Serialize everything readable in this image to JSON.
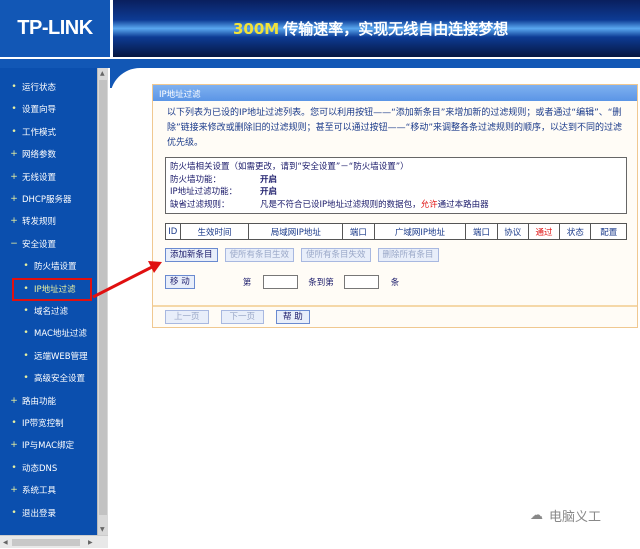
{
  "header": {
    "logo": "TP-LINK",
    "banner_highlight": "300M",
    "banner_text": "传输速率，实现无线自由连接梦想"
  },
  "sidebar": {
    "items": [
      {
        "label": "运行状态",
        "bullet": "•",
        "level": 1
      },
      {
        "label": "设置向导",
        "bullet": "•",
        "level": 1
      },
      {
        "label": "工作模式",
        "bullet": "•",
        "level": 1
      },
      {
        "label": "网络参数",
        "bullet": "+",
        "level": 1
      },
      {
        "label": "无线设置",
        "bullet": "+",
        "level": 1
      },
      {
        "label": "DHCP服务器",
        "bullet": "+",
        "level": 1
      },
      {
        "label": "转发规则",
        "bullet": "+",
        "level": 1
      },
      {
        "label": "安全设置",
        "bullet": "−",
        "level": 1
      },
      {
        "label": "防火墙设置",
        "bullet": "•",
        "level": 2
      },
      {
        "label": "IP地址过滤",
        "bullet": "•",
        "level": 2,
        "selected": true
      },
      {
        "label": "域名过滤",
        "bullet": "•",
        "level": 2
      },
      {
        "label": "MAC地址过滤",
        "bullet": "•",
        "level": 2
      },
      {
        "label": "远端WEB管理",
        "bullet": "•",
        "level": 2
      },
      {
        "label": "高级安全设置",
        "bullet": "•",
        "level": 2
      },
      {
        "label": "路由功能",
        "bullet": "+",
        "level": 1
      },
      {
        "label": "IP带宽控制",
        "bullet": "•",
        "level": 1
      },
      {
        "label": "IP与MAC绑定",
        "bullet": "+",
        "level": 1
      },
      {
        "label": "动态DNS",
        "bullet": "•",
        "level": 1
      },
      {
        "label": "系统工具",
        "bullet": "+",
        "level": 1
      },
      {
        "label": "退出登录",
        "bullet": "•",
        "level": 1
      }
    ]
  },
  "panel": {
    "title": "IP地址过滤",
    "description": "以下列表为已设的IP地址过滤列表。您可以利用按钮——“添加新条目”来增加新的过滤规则；或者通过“编辑”、“删除”链接来修改或删除旧的过滤规则；甚至可以通过按钮——“移动”来调整各条过滤规则的顺序，以达到不同的过滤优先级。",
    "firewall": {
      "heading": "防火墙相关设置（如需更改，请到“安全设置”－“防火墙设置”）",
      "fw_label": "防火墙功能：",
      "fw_value": "开启",
      "ip_label": "IP地址过滤功能：",
      "ip_value": "开启",
      "default_label": "缺省过滤规则：",
      "default_pre": "凡是不符合已设IP地址过滤规则的数据包，",
      "default_red": "允许",
      "default_post": "通过本路由器"
    },
    "columns": [
      "ID",
      "生效时间",
      "局域网IP地址",
      "端口",
      "广域网IP地址",
      "端口",
      "协议",
      "通过",
      "状态",
      "配置"
    ],
    "buttons": {
      "add": "添加新条目",
      "enable_all": "使所有条目生效",
      "disable_all": "使所有条目失效",
      "delete_all": "删除所有条目"
    },
    "move": {
      "button": "移 动",
      "from": "第",
      "to": "条到第",
      "unit": "条",
      "from_value": "",
      "to_value": ""
    },
    "footer": {
      "prev": "上一页",
      "next": "下一页",
      "help": "帮 助"
    }
  },
  "watermark": "电脑义工",
  "colors": {
    "brand": "#1257b5",
    "accent_red": "#e01010"
  }
}
